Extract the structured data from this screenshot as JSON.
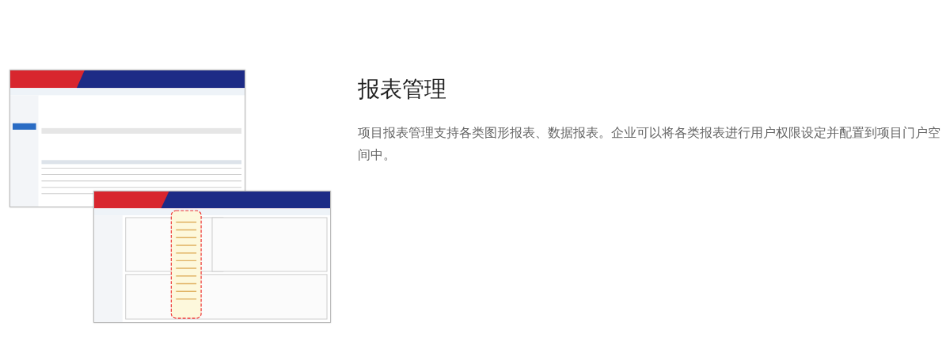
{
  "title": "报表管理",
  "description": "项目报表管理支持各类图形报表、数据报表。企业可以将各类报表进行用户权限设定并配置到项目门户空间中。"
}
